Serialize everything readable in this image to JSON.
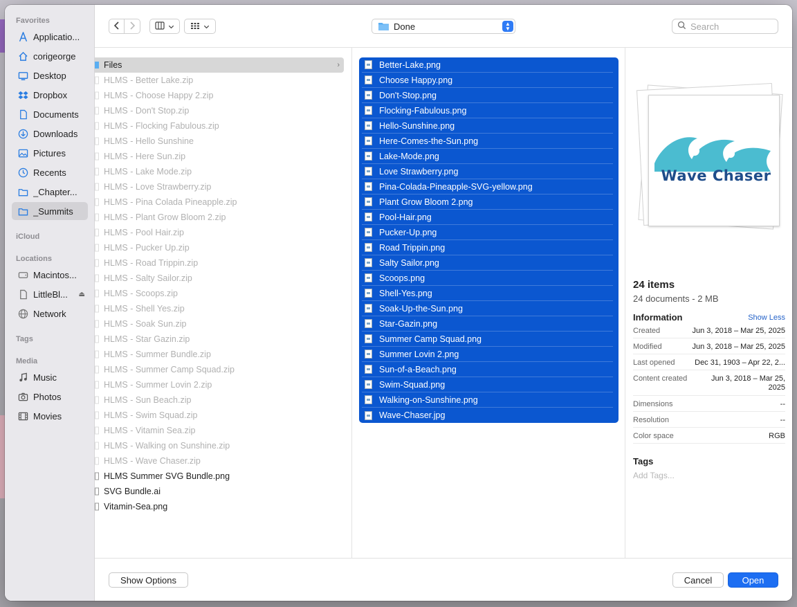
{
  "sidebar": {
    "sections": {
      "favorites": "Favorites",
      "icloud": "iCloud",
      "locations": "Locations",
      "tags": "Tags",
      "media": "Media"
    },
    "favorites": [
      {
        "label": "Applicatio...",
        "icon": "applications-icon"
      },
      {
        "label": "corigeorge",
        "icon": "home-icon"
      },
      {
        "label": "Desktop",
        "icon": "desktop-icon"
      },
      {
        "label": "Dropbox",
        "icon": "dropbox-icon"
      },
      {
        "label": "Documents",
        "icon": "document-icon"
      },
      {
        "label": "Downloads",
        "icon": "downloads-icon"
      },
      {
        "label": "Pictures",
        "icon": "pictures-icon"
      },
      {
        "label": "Recents",
        "icon": "clock-icon"
      },
      {
        "label": "_Chapter...",
        "icon": "folder-icon"
      },
      {
        "label": "_Summits",
        "icon": "folder-icon"
      }
    ],
    "locations": [
      {
        "label": "Macintos...",
        "icon": "disk-icon"
      },
      {
        "label": "LittleBl...",
        "icon": "external-disk-icon"
      },
      {
        "label": "Network",
        "icon": "network-icon"
      }
    ],
    "media": [
      {
        "label": "Music",
        "icon": "music-icon"
      },
      {
        "label": "Photos",
        "icon": "camera-icon"
      },
      {
        "label": "Movies",
        "icon": "film-icon"
      }
    ]
  },
  "toolbar": {
    "path": "Done",
    "search_placeholder": "Search"
  },
  "column1": {
    "selected_folder": "Files",
    "items": [
      {
        "label": "HLMS - Better Lake.zip",
        "dim": true
      },
      {
        "label": "HLMS - Choose Happy 2.zip",
        "dim": true
      },
      {
        "label": "HLMS - Don't Stop.zip",
        "dim": true
      },
      {
        "label": "HLMS - Flocking Fabulous.zip",
        "dim": true
      },
      {
        "label": "HLMS - Hello Sunshine",
        "dim": true
      },
      {
        "label": "HLMS - Here Sun.zip",
        "dim": true
      },
      {
        "label": "HLMS - Lake Mode.zip",
        "dim": true
      },
      {
        "label": "HLMS - Love Strawberry.zip",
        "dim": true
      },
      {
        "label": "HLMS - Pina Colada Pineapple.zip",
        "dim": true
      },
      {
        "label": "HLMS - Plant Grow Bloom 2.zip",
        "dim": true
      },
      {
        "label": "HLMS - Pool Hair.zip",
        "dim": true
      },
      {
        "label": "HLMS - Pucker Up.zip",
        "dim": true
      },
      {
        "label": "HLMS - Road Trippin.zip",
        "dim": true
      },
      {
        "label": "HLMS - Salty Sailor.zip",
        "dim": true
      },
      {
        "label": "HLMS - Scoops.zip",
        "dim": true
      },
      {
        "label": "HLMS - Shell Yes.zip",
        "dim": true
      },
      {
        "label": "HLMS - Soak Sun.zip",
        "dim": true
      },
      {
        "label": "HLMS - Star Gazin.zip",
        "dim": true
      },
      {
        "label": "HLMS - Summer Bundle.zip",
        "dim": true
      },
      {
        "label": "HLMS - Summer Camp Squad.zip",
        "dim": true
      },
      {
        "label": "HLMS - Summer Lovin 2.zip",
        "dim": true
      },
      {
        "label": "HLMS - Sun Beach.zip",
        "dim": true
      },
      {
        "label": "HLMS - Swim Squad.zip",
        "dim": true
      },
      {
        "label": "HLMS - Vitamin Sea.zip",
        "dim": true
      },
      {
        "label": "HLMS - Walking on Sunshine.zip",
        "dim": true
      },
      {
        "label": "HLMS - Wave Chaser.zip",
        "dim": true
      },
      {
        "label": "HLMS Summer SVG Bundle.png",
        "dim": false
      },
      {
        "label": "SVG Bundle.ai",
        "dim": false
      },
      {
        "label": "Vitamin-Sea.png",
        "dim": false
      }
    ]
  },
  "column2": {
    "items": [
      "Better-Lake.png",
      "Choose Happy.png",
      "Don't-Stop.png",
      "Flocking-Fabulous.png",
      "Hello-Sunshine.png",
      "Here-Comes-the-Sun.png",
      "Lake-Mode.png",
      "Love Strawberry.png",
      "Pina-Colada-Pineapple-SVG-yellow.png",
      "Plant Grow Bloom 2.png",
      "Pool-Hair.png",
      "Pucker-Up.png",
      "Road Trippin.png",
      "Salty Sailor.png",
      "Scoops.png",
      "Shell-Yes.png",
      "Soak-Up-the-Sun.png",
      "Star-Gazin.png",
      "Summer Camp Squad.png",
      "Summer Lovin 2.png",
      "Sun-of-a-Beach.png",
      "Swim-Squad.png",
      "Walking-on-Sunshine.png",
      "Wave-Chaser.jpg"
    ]
  },
  "preview": {
    "thumb_text": "Wave Chaser",
    "count": "24 items",
    "summary": "24 documents - 2 MB",
    "information_label": "Information",
    "show_less": "Show Less",
    "fields": [
      {
        "key": "Created",
        "value": "Jun 3, 2018 – Mar 25, 2025"
      },
      {
        "key": "Modified",
        "value": "Jun 3, 2018 – Mar 25, 2025"
      },
      {
        "key": "Last opened",
        "value": "Dec 31, 1903 – Apr 22, 2..."
      },
      {
        "key": "Content created",
        "value": "Jun 3, 2018 – Mar 25, 2025"
      },
      {
        "key": "Dimensions",
        "value": "--"
      },
      {
        "key": "Resolution",
        "value": "--"
      },
      {
        "key": "Color space",
        "value": "RGB"
      }
    ],
    "tags_label": "Tags",
    "tags_placeholder": "Add Tags..."
  },
  "bottom": {
    "show_options": "Show Options",
    "cancel": "Cancel",
    "open": "Open"
  },
  "colors": {
    "selection": "#0b57d0",
    "primary_button": "#1d6ef2",
    "sidebar_icon": "#2a7de1",
    "wave": "#4bbcd0",
    "wave_text": "#1f4d8a"
  }
}
